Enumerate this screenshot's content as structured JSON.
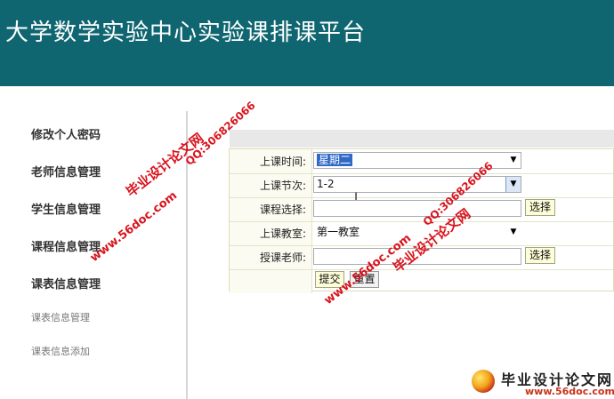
{
  "header": {
    "title": "大学数学实验中心实验课排课平台"
  },
  "sidebar": {
    "items": [
      {
        "label": "修改个人密码"
      },
      {
        "label": "老师信息管理"
      },
      {
        "label": "学生信息管理"
      },
      {
        "label": "课程信息管理"
      },
      {
        "label": "课表信息管理"
      }
    ],
    "subitems": [
      {
        "label": "课表信息管理"
      },
      {
        "label": "课表信息添加"
      }
    ]
  },
  "form": {
    "time": {
      "label": "上课时间:",
      "value": "星期二"
    },
    "period": {
      "label": "上课节次:",
      "value": "1-2"
    },
    "course": {
      "label": "课程选择:",
      "value": "",
      "button": "选择"
    },
    "room": {
      "label": "上课教室:",
      "value": "第一教室"
    },
    "teacher": {
      "label": "授课老师:",
      "value": "",
      "button": "选择"
    },
    "submit_label": "提交",
    "reset_label": "重置"
  },
  "watermarks": {
    "site": "www.56doc.com",
    "qq": "QQ:306826066",
    "brand": "毕业设计论文网"
  },
  "logo": {
    "title": "毕业设计论文网",
    "url": "www.56doc.com"
  }
}
